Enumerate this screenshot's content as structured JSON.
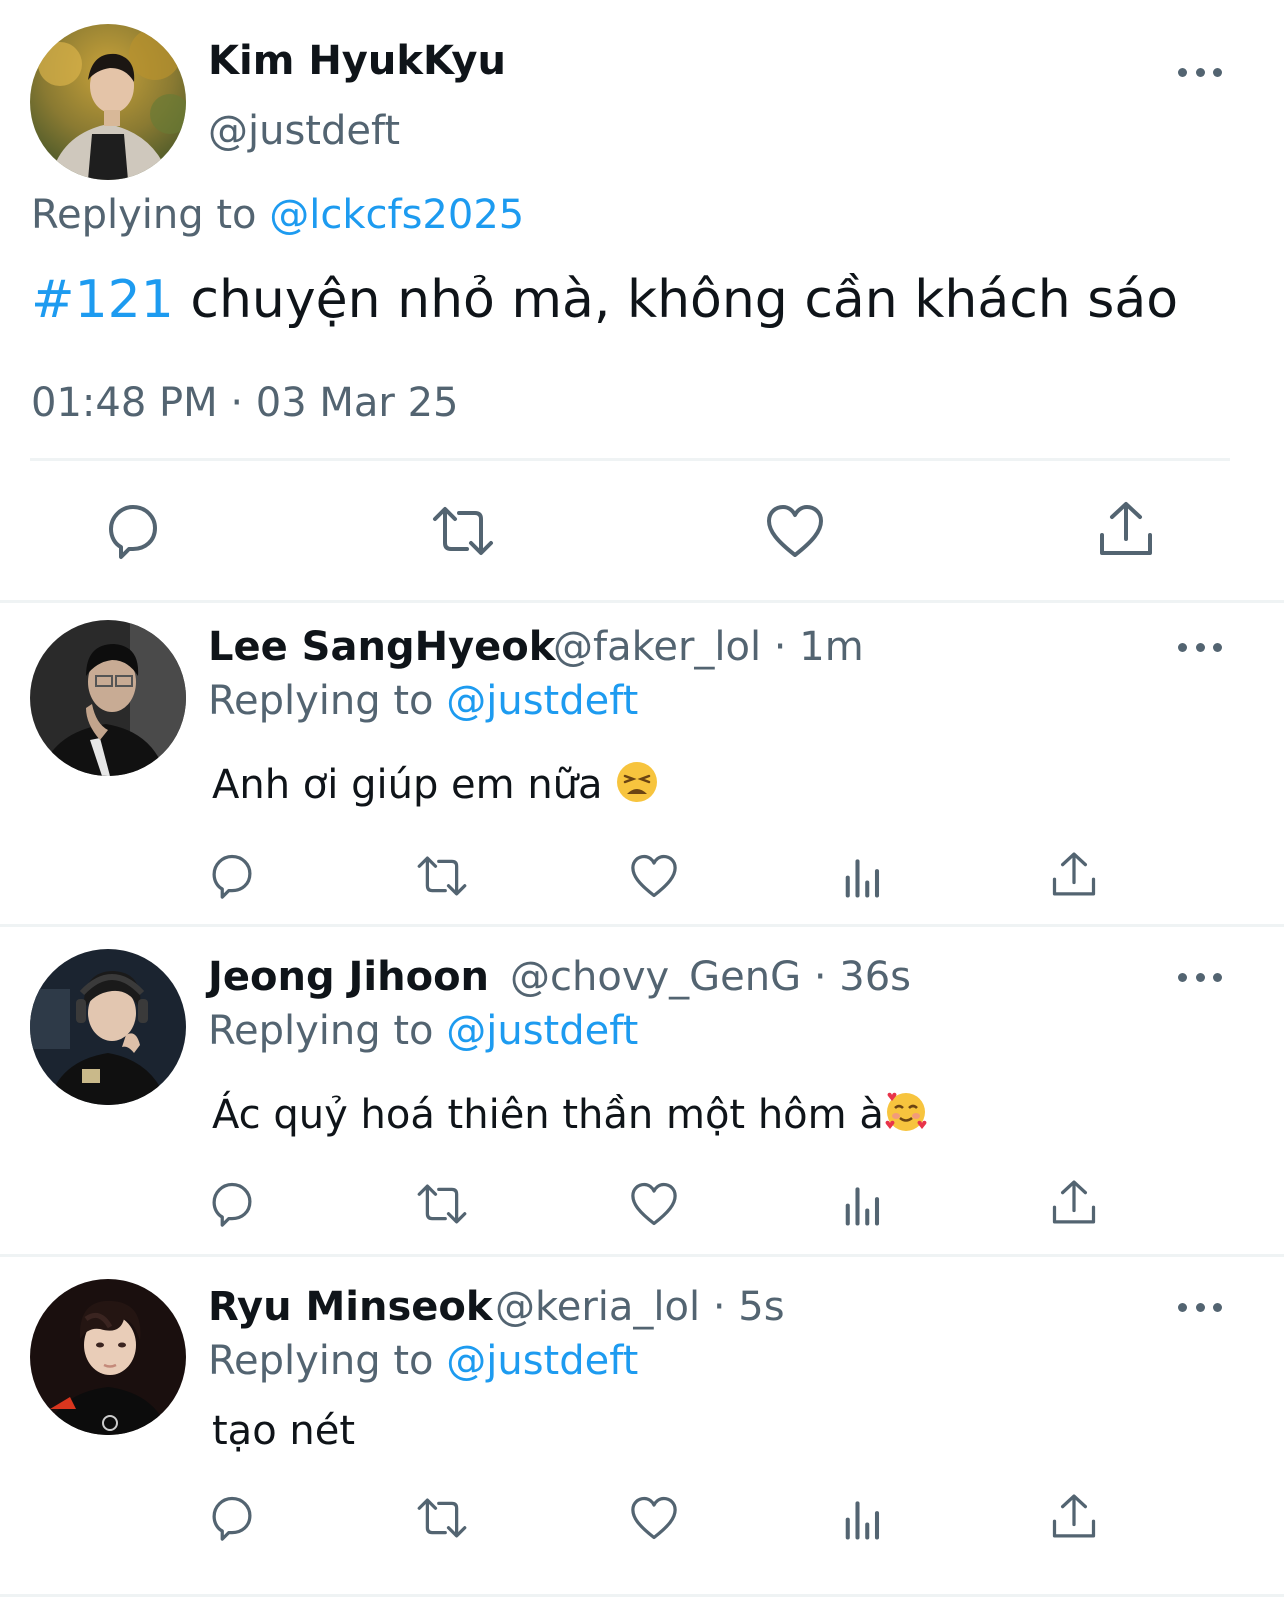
{
  "main_tweet": {
    "name": "Kim HyukKyu",
    "handle": "@justdeft",
    "replying_prefix": "Replying to ",
    "replying_to": "@lckcfs2025",
    "hashtag": "#121",
    "text": " chuyện nhỏ mà, không cần khách sáo",
    "timestamp": "01:48 PM · 03 Mar 25"
  },
  "replies": [
    {
      "name": "Lee SangHyeok",
      "handle": "@faker_lol",
      "time": " · 1m",
      "replying_prefix": "Replying to ",
      "replying_to": "@justdeft",
      "text": "Anh ơi giúp em nữa ",
      "emoji": "tired-face-emoji"
    },
    {
      "name": "Jeong Jihoon",
      "handle": "@chovy_GenG",
      "time": " · 36s",
      "replying_prefix": "Replying to ",
      "replying_to": "@justdeft",
      "text": "Ác quỷ hoá thiên thần một hôm à",
      "emoji": "smiling-face-with-hearts-emoji"
    },
    {
      "name": "Ryu Minseok",
      "handle": "@keria_lol",
      "time": " · 5s",
      "replying_prefix": "Replying to ",
      "replying_to": "@justdeft",
      "text": "tạo nét"
    }
  ],
  "icons": {
    "reply": "speech-bubble-icon",
    "retweet": "retweet-icon",
    "like": "heart-icon",
    "views": "bar-chart-icon",
    "share": "share-icon",
    "more": "ellipsis-icon"
  },
  "colors": {
    "link": "#1d9bf0",
    "secondary_text": "#536471",
    "primary_text": "#0f1419",
    "divider": "#eff3f4"
  }
}
